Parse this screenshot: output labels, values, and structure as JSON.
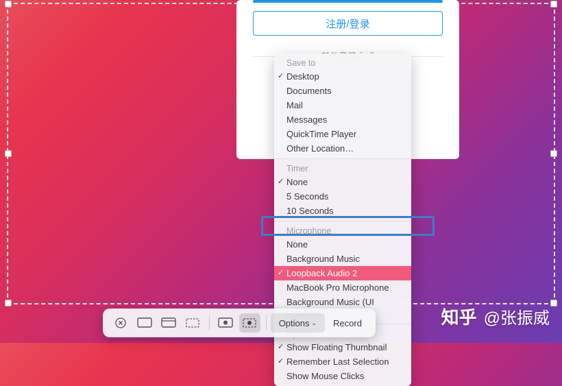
{
  "login": {
    "button_label": "注册/登录",
    "other_login_label": "其他登录方式"
  },
  "menu": {
    "save_to": {
      "title": "Save to",
      "items": [
        "Desktop",
        "Documents",
        "Mail",
        "Messages",
        "QuickTime Player",
        "Other Location…"
      ],
      "checked": "Desktop"
    },
    "timer": {
      "title": "Timer",
      "items": [
        "None",
        "5 Seconds",
        "10 Seconds"
      ],
      "checked": "None"
    },
    "microphone": {
      "title": "Microphone",
      "items": [
        "None",
        "Background Music",
        "Loopback Audio 2",
        "MacBook Pro Microphone",
        "Background Music (UI Sounds)"
      ],
      "checked": "Loopback Audio 2",
      "highlighted": "Loopback Audio 2"
    },
    "options": {
      "title": "Options",
      "items": [
        "Show Floating Thumbnail",
        "Remember Last Selection",
        "Show Mouse Clicks"
      ],
      "checked": [
        "Show Floating Thumbnail",
        "Remember Last Selection"
      ]
    }
  },
  "toolbar": {
    "options_label": "Options",
    "record_label": "Record"
  },
  "watermark": {
    "site": "知乎",
    "author": "@张振威"
  }
}
